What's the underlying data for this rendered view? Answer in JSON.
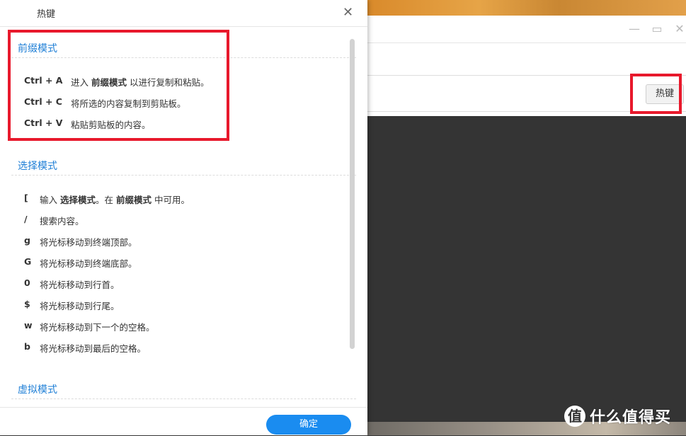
{
  "dialog": {
    "title": "热键",
    "close_glyph": "✕",
    "ok_label": "确定",
    "sections": {
      "prefix": {
        "title": "前缀模式",
        "rows": [
          {
            "key": "Ctrl + A",
            "desc_pre": "进入 ",
            "desc_bold": "前缀模式",
            "desc_post": " 以进行复制和粘贴。"
          },
          {
            "key": "Ctrl + C",
            "desc": "将所选的内容复制到剪贴板。"
          },
          {
            "key": "Ctrl + V",
            "desc": "粘贴剪贴板的内容。"
          }
        ]
      },
      "select": {
        "title": "选择模式",
        "rows": [
          {
            "key": "[",
            "desc_pre": "输入 ",
            "desc_bold": "选择模式",
            "desc_mid": "。在 ",
            "desc_bold2": "前缀模式",
            "desc_post": " 中可用。"
          },
          {
            "key": "/",
            "desc": "搜索内容。"
          },
          {
            "key": "g",
            "desc": "将光标移动到终端顶部。"
          },
          {
            "key": "G",
            "desc": "将光标移动到终端底部。"
          },
          {
            "key": "0",
            "desc": "将光标移动到行首。"
          },
          {
            "key": "$",
            "desc": "将光标移动到行尾。"
          },
          {
            "key": "w",
            "desc": "将光标移动到下一个的空格。"
          },
          {
            "key": "b",
            "desc": "将光标移动到最后的空格。"
          }
        ]
      },
      "virtual": {
        "title": "虚拟模式"
      }
    }
  },
  "background_window": {
    "hotkey_button_label": "热键",
    "controls": {
      "minimize": "—",
      "maximize": "▭",
      "close": "✕"
    }
  },
  "watermark": {
    "logo_glyph": "值",
    "text": "什么值得买"
  },
  "colors": {
    "accent": "#1f7fd6",
    "primary_button": "#1a8cf0",
    "highlight_box": "#e8192c",
    "terminal_bg": "#343434"
  }
}
